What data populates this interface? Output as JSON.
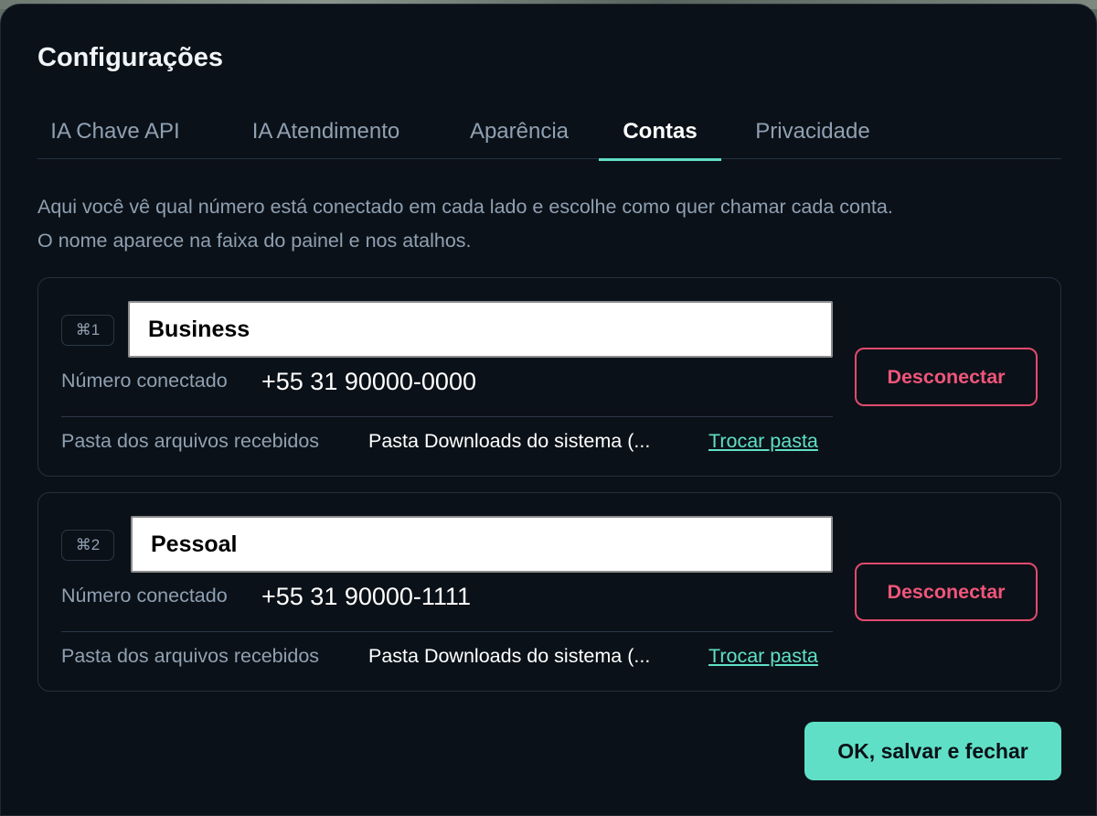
{
  "dialog": {
    "title": "Configurações",
    "description_line1": "Aqui você vê qual número está conectado em cada lado e escolhe como quer chamar cada conta.",
    "description_line2": "O nome aparece na faixa do painel e nos atalhos."
  },
  "tabs": [
    {
      "label": "IA Chave API",
      "active": false
    },
    {
      "label": "IA Atendimento",
      "active": false
    },
    {
      "label": "Aparência",
      "active": false
    },
    {
      "label": "Contas",
      "active": true
    },
    {
      "label": "Privacidade",
      "active": false
    }
  ],
  "accounts": [
    {
      "shortcut": "⌘1",
      "name": "Business",
      "number_label": "Número conectado",
      "number": "+55 31 90000-0000",
      "folder_label": "Pasta dos arquivos recebidos",
      "folder": "Pasta Downloads do sistema (...",
      "change_folder": "Trocar pasta",
      "disconnect": "Desconectar"
    },
    {
      "shortcut": "⌘2",
      "name": "Pessoal",
      "number_label": "Número conectado",
      "number": "+55 31 90000-1111",
      "folder_label": "Pasta dos arquivos recebidos",
      "folder": "Pasta Downloads do sistema (...",
      "change_folder": "Trocar pasta",
      "disconnect": "Desconectar"
    }
  ],
  "footer": {
    "ok_label": "OK, salvar e fechar"
  },
  "colors": {
    "accent": "#5fe0c6",
    "danger": "#f0557a",
    "background": "#0b1118",
    "muted_text": "#8fa0b2"
  }
}
